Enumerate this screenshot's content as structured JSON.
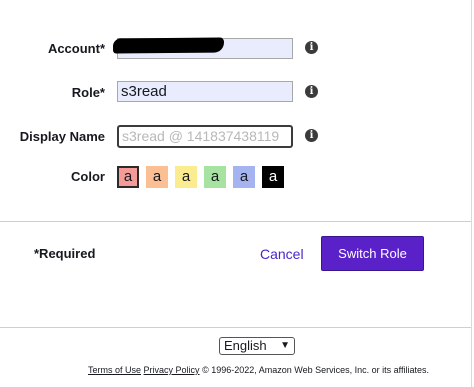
{
  "form": {
    "account_label": "Account*",
    "role_label": "Role*",
    "role_value": "s3read",
    "display_name_label": "Display Name",
    "display_name_placeholder": "s3read @ 141837438119",
    "color_label": "Color",
    "info_glyph": "i",
    "swatches": [
      {
        "letter": "a",
        "color": "#f49a97",
        "selected": true
      },
      {
        "letter": "a",
        "color": "#fbbf93"
      },
      {
        "letter": "a",
        "color": "#faec8f"
      },
      {
        "letter": "a",
        "color": "#a7e3a0"
      },
      {
        "letter": "a",
        "color": "#a5b4f0"
      },
      {
        "letter": "a",
        "color": "#000000",
        "text_color": "#ffffff"
      }
    ]
  },
  "actions": {
    "required_note": "*Required",
    "cancel_label": "Cancel",
    "switch_role_label": "Switch Role"
  },
  "footer": {
    "language": "English",
    "terms_link": "Terms of Use",
    "privacy_link": "Privacy Policy",
    "copyright": "© 1996-2022, Amazon Web Services, Inc. or its affiliates."
  },
  "colors": {
    "accent": "#5a21c9",
    "link": "#4a26c9",
    "field_bg": "#e8ecfd"
  }
}
